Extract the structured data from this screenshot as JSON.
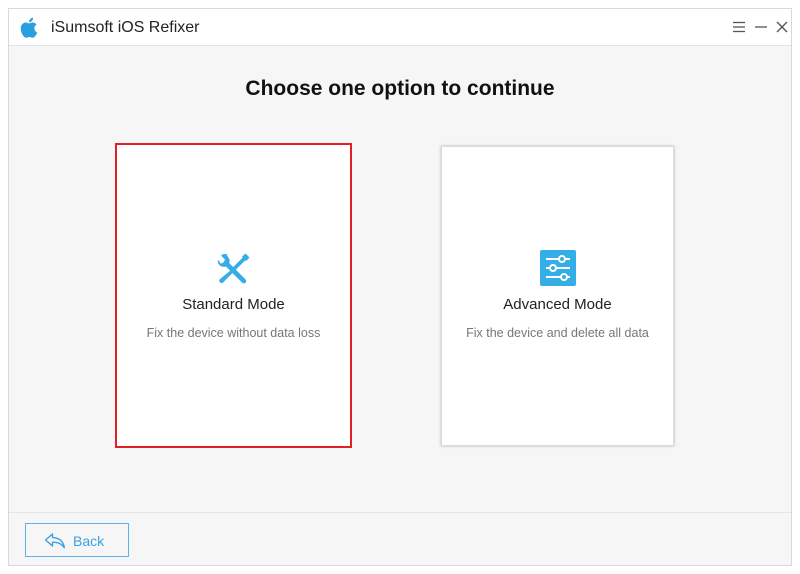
{
  "window": {
    "title": "iSumsoft iOS Refixer",
    "controls": [
      "menu-icon",
      "minimize-icon",
      "close-icon"
    ]
  },
  "main": {
    "heading": "Choose one option to continue",
    "modes": [
      {
        "name": "Standard Mode",
        "description": "Fix the device without data loss",
        "icon": "wrench-screwdriver-icon",
        "selected": true
      },
      {
        "name": "Advanced Mode",
        "description": "Fix the device and delete all data",
        "icon": "sliders-icon",
        "selected": false
      }
    ]
  },
  "footer": {
    "back_label": "Back",
    "back_icon": "back-arrow-icon"
  },
  "colors": {
    "accent": "#35aee8",
    "selected_border": "#e31e24",
    "back_text": "#3aa0e3"
  }
}
